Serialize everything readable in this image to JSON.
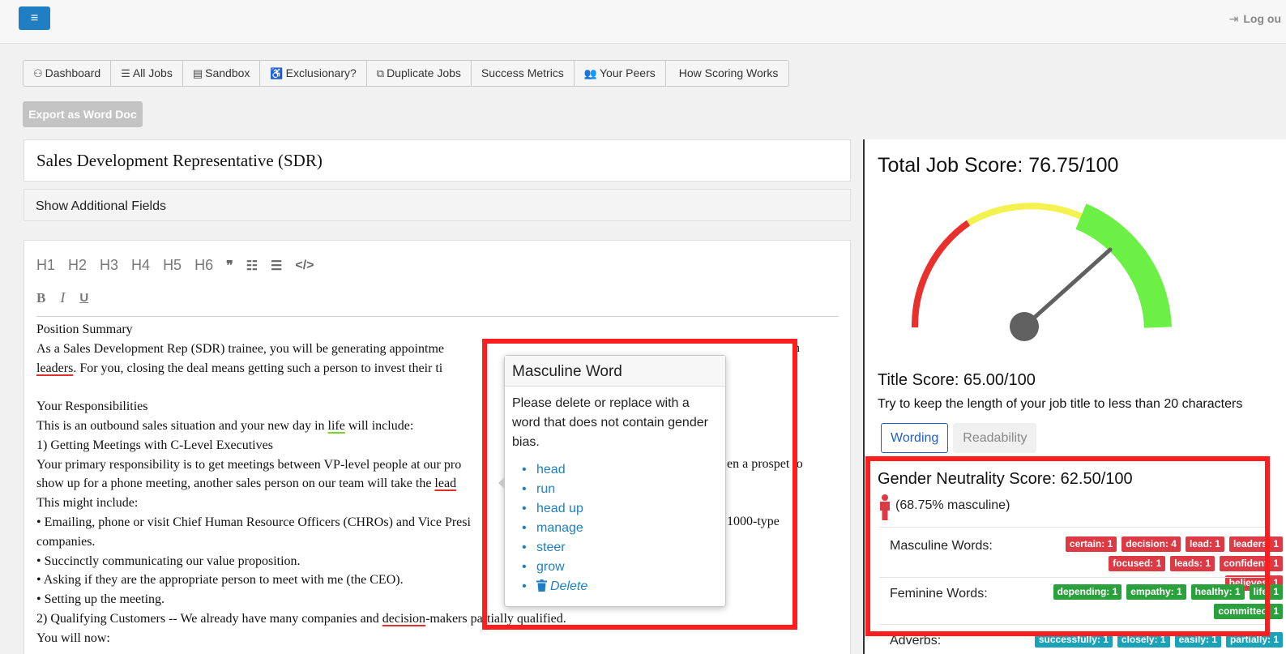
{
  "topbar": {
    "logout": "Log ou"
  },
  "nav": [
    {
      "icon": "dashboard-icon",
      "glyph": "⚇",
      "label": "Dashboard"
    },
    {
      "icon": "list-icon",
      "glyph": "☰",
      "label": "All Jobs"
    },
    {
      "icon": "sandbox-icon",
      "glyph": "▤",
      "label": "Sandbox"
    },
    {
      "icon": "accessibility-icon",
      "glyph": "♿",
      "label": "Exclusionary?"
    },
    {
      "icon": "copy-icon",
      "glyph": "⧉",
      "label": "Duplicate Jobs"
    },
    {
      "icon": "",
      "glyph": "",
      "label": "Success Metrics"
    },
    {
      "icon": "users-icon",
      "glyph": "👥",
      "label": "Your Peers"
    },
    {
      "icon": "",
      "glyph": "",
      "label": "How Scoring Works"
    }
  ],
  "export_label": "Export as Word Doc",
  "job_title": "Sales Development Representative (SDR)",
  "additional_fields": "Show Additional Fields",
  "toolbar": {
    "h1": "H1",
    "h2": "H2",
    "h3": "H3",
    "h4": "H4",
    "h5": "H5",
    "h6": "H6",
    "quote": "❞",
    "ul": "☷",
    "ol": "☰",
    "code": "</>",
    "bold": "B",
    "italic": "I",
    "underline": "U"
  },
  "editor_lines": {
    "l1": "Position Summary",
    "l2": "As a Sales Development Rep (SDR) trainee, you will be generating appointme",
    "l2b": "n",
    "l3a": "leaders",
    "l3b": ". For you, closing the deal means getting such a person to invest their ti",
    "l4": "",
    "l5": "Your Responsibilities",
    "l6a": "This is an outbound sales situation and your new day in ",
    "l6b": "life",
    "l6c": " will include:",
    "l7": "1) Getting Meetings with C-Level Executives",
    "l8a": "Your primary responsibility is to get meetings between VP-level people at our pro",
    "l8b": "en a prospe",
    "l8c": "t to",
    "l9a": "show up for a phone meeting, another sales person on our team will take the ",
    "l9b": "le",
    "l9c": "ad",
    "l10": "This might include:",
    "l11a": "• Emailing, phone or visit Chief Human Resource Officers (CHROs) and Vice Presi",
    "l11b": "1000-type",
    "l12": "companies.",
    "l13": "• Succinctly communicating our value proposition.",
    "l14": "• Asking if they are the appropriate person to meet with me (the CEO).",
    "l15": "• Setting up the meeting.",
    "l16a": "2) Qualifying Customers -- We already have many companies and ",
    "l16b": "decision",
    "l16c": "-ma",
    "l16d": "kers partially qualified.",
    "l17": "You will now:"
  },
  "popover": {
    "title": "Masculine Word",
    "body": "Please delete or replace with a word that does not contain gender bias.",
    "suggestions": [
      "head",
      "run",
      "head up",
      "manage",
      "steer",
      "grow"
    ],
    "delete_label": "Delete"
  },
  "scores": {
    "total": "Total Job Score: 76.75/100",
    "total_value": 76.75,
    "title_score": "Title Score: 65.00/100",
    "title_tip": "Try to keep the length of your job title to less than 20 characters",
    "tab_wording": "Wording",
    "tab_readability": "Readability",
    "gender": "Gender Neutrality Score: 62.50/100",
    "masculine_pct": "(68.75% masculine)",
    "masculine_label": "Masculine Words:",
    "feminine_label": "Feminine Words:",
    "adverbs_label": "Adverbs:",
    "masculine_words": [
      "certain: 1",
      "decision: 4",
      "lead: 1",
      "leaders: 1",
      "focused: 1",
      "leads: 1",
      "confident: 1",
      "believes: 1"
    ],
    "feminine_words": [
      "depending: 1",
      "empathy: 1",
      "healthy: 1",
      "life: 1",
      "committed: 1"
    ],
    "adverbs": [
      "successfully: 1",
      "closely: 1",
      "easily: 1",
      "partially: 1"
    ]
  },
  "colors": {
    "accent": "#1f7fc2",
    "gauge_red": "#e8302c",
    "gauge_yellow": "#f4f24e",
    "gauge_green": "#6cf045",
    "highlight": "#ff1d1d"
  }
}
